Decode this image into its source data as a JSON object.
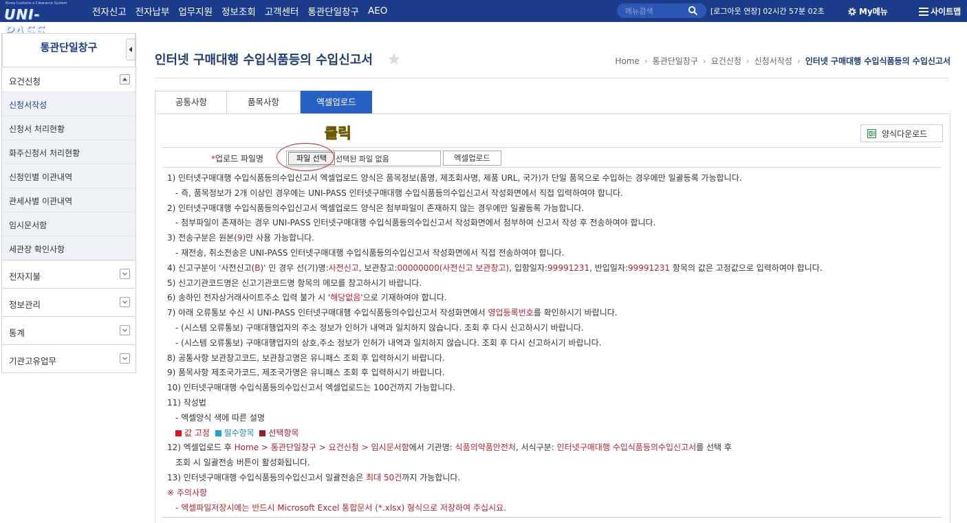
{
  "header": {
    "logo_small": "Korea Customs e-Clearance System",
    "logo_text": "UNI-PASS",
    "nav": [
      "전자신고",
      "전자납부",
      "업무지원",
      "정보조회",
      "고객센터",
      "통관단일창구",
      "AEO"
    ],
    "search_placeholder": "메뉴검색",
    "session": "[로그아웃 연장] 02시간 57분 02초",
    "mymenu": "My메뉴",
    "sitemap": "사이트맵"
  },
  "sidebar": {
    "title": "통관단일창구",
    "group1": "요건신청",
    "items": [
      "신청서작성",
      "신청서 처리현황",
      "화주신청서 처리현황",
      "신청인별 이관내역",
      "관세사별 이관내역",
      "임시문서함",
      "세관장 확인사항"
    ],
    "folds": [
      "전자지불",
      "정보관리",
      "통계",
      "기관고유업무"
    ]
  },
  "page": {
    "title": "인터넷 구매대행 수입식품등의 수입신고서",
    "breadcrumb": [
      "Home",
      "통관단일창구",
      "요건신청",
      "신청서작성",
      "인터넷 구매대행 수입식품등의 수입신고서"
    ]
  },
  "tabs": [
    "공통사항",
    "품목사항",
    "엑셀업로드"
  ],
  "upload": {
    "click_label": "클릭",
    "download_label": "양식다운로드",
    "file_label_star": "*",
    "file_label": "업로드 파일명",
    "file_button": "파일 선택",
    "file_status": "선택된 파일 없음",
    "excel_button": "엑셀업로드"
  },
  "notes": {
    "n1": "1) 인터넷구매대행 수입식품등의수입신고서 엑셀업로드 양식은 품목정보(품명, 제조회사명, 제품 URL, 국가)가 단일 품목으로 수입하는 경우에만 일괄등록 가능합니다.",
    "n1a": "- 즉, 품목정보가 2개 이상인 경우에는 UNI-PASS 인터넷구매대행 수입식품등의수입신고서 작성화면에서 직접 입력하여야 합니다.",
    "n2": "2) 인터넷구매대행 수입식품등의수입신고서 엑셀업로드 양식은 첨부파일이 존재하지 않는 경우에만 일괄등록 가능합니다.",
    "n2a": "- 첨부파일이 존재하는 경우 UNI-PASS 인터넷구매대행 수입식품등의수입신고서 작성화면에서 첨부하여 신고서 작성 후 전송하여야 합니다.",
    "n3_pre": "3) 전송구분은 원본(",
    "n3_red": "9",
    "n3_post": ")만 사용 가능합니다.",
    "n3a": "- 재전송, 취소전송은 UNI-PASS 인터넷구매대행 수입식품등의수입신고서 작성화면에서 직접 전송하여야 합니다.",
    "n4_p1": "4) 신고구분이 '사전신고(",
    "n4_r1": "B",
    "n4_p2": ")' 인 경우 선(기)명:",
    "n4_r2": "사전신고",
    "n4_p3": ", 보관창고:",
    "n4_r3": "00000000(사전신고 보관창고)",
    "n4_p4": ", 입항일자:",
    "n4_r4": "99991231",
    "n4_p5": ", 반입일자:",
    "n4_r5": "99991231",
    "n4_p6": " 항목의 값은 고정값으로 입력하여야 합니다.",
    "n5": "5) 신고기관코드명은 신고기관코드명 항목의 메모를 참고하시기 바랍니다.",
    "n6_p1": "6) 송하인 전자상거래사이트주소 입력 불가 시 '",
    "n6_r1": "해당없음",
    "n6_p2": "'으로 기재하여야 합니다.",
    "n7_p1": "7) 아래 오류통보 수신 시 UNI-PASS 인터넷구매대행 수입식품등의수입신고서 작성화면에서 ",
    "n7_r1": "영업등록번호",
    "n7_p2": "를 확인하시기 바랍니다.",
    "n7a": "- (시스템 오류통보) 구매대행업자의 주소 정보가 인허가 내역과 일치하지 않습니다. 조회 후 다시 신고하시기 바랍니다.",
    "n7b": "- (시스템 오류통보) 구매대행업자의 상호,주소 정보가 인허가 내역과 일치하지 않습니다. 조회 후 다시 신고하시기 바랍니다.",
    "n8": "8) 공통사항 보관창고코드, 보관창고명은 유니패스 조회 후 입력하시기 바랍니다.",
    "n9": "9) 품목사항 제조국가코드, 제조국가명은 유니패스 조회 후 입력하시기 바랍니다.",
    "n10": "10) 인터넷구매대행 수입식품등의수입신고서 엑셀업로드는 100건까지 가능합니다.",
    "n11": "11) 작성법",
    "n11a": "- 엑셀양식 색에 따른 설명",
    "legend_fixed": "값 고정",
    "legend_required": "필수항목",
    "legend_optional": "선택항목",
    "n12_p1": "12) 엑셀업로드 후 ",
    "n12_r1": "Home > 통관단일창구 > 요건신청 > 임시문서함",
    "n12_p2": "에서 기관명: ",
    "n12_r2": "식품의약품안전처",
    "n12_p3": ", 서식구분: ",
    "n12_r3": "인터넷구매대행 수입식품등의수입신고서",
    "n12_p4": "를 선택 후",
    "n12b": "조회 시 일괄전송 버튼이 활성화됩니다.",
    "n13_p1": "13) 인터넷구매대행 수입식품등의수입신고서 일괄전송은 ",
    "n13_r1": "최대 50건",
    "n13_p2": "까지 가능합니다.",
    "caution": "※ 주의사항",
    "caution_a": "- 엑셀파일저장시에는 반드시 Microsoft Excel 통합문서 (*.xlsx) 형식으로 저장하여 주십시요."
  },
  "colors": {
    "header_bg": "#1a3c8a",
    "tab_active": "#2861c4",
    "legend_fixed": "#e0141e",
    "legend_required": "#1aa6d8",
    "legend_optional": "#9b1c22"
  }
}
